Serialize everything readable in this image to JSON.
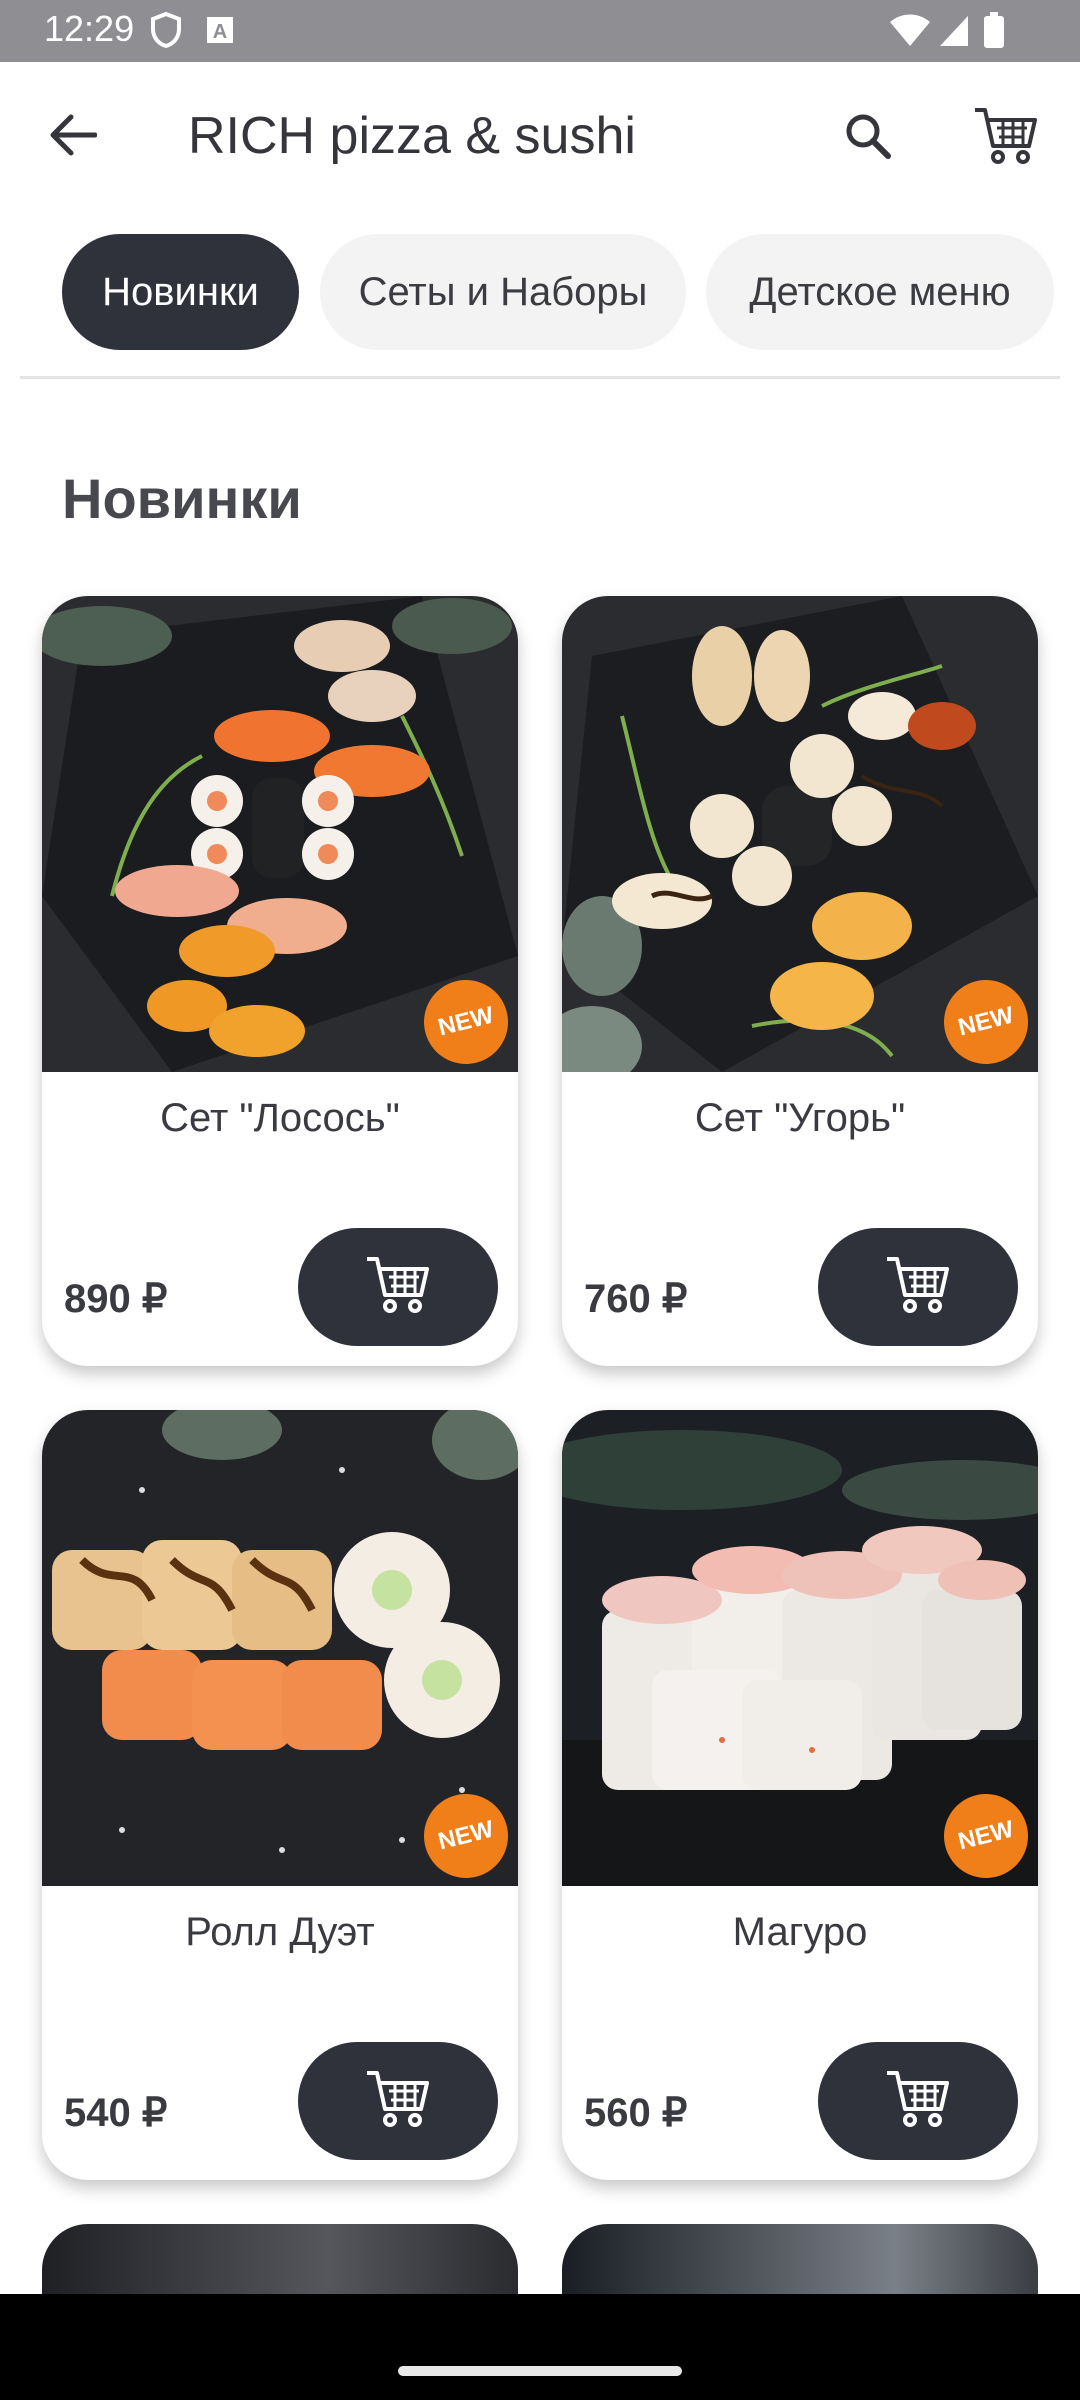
{
  "status_bar": {
    "time": "12:29",
    "icons": [
      "shield-icon",
      "a-box-icon",
      "wifi-icon",
      "signal-icon",
      "battery-icon"
    ]
  },
  "app_bar": {
    "title": "RICH pizza & sushi",
    "icons": [
      "back-arrow-icon",
      "search-icon",
      "cart-icon"
    ]
  },
  "tabs": [
    {
      "label": "Новинки",
      "active": true
    },
    {
      "label": "Сеты и Наборы",
      "active": false
    },
    {
      "label": "Детское меню",
      "active": false
    }
  ],
  "section": {
    "title": "Новинки"
  },
  "products": [
    {
      "name": "Сет \"Лосось\"",
      "price": "890 ₽",
      "badge": "NEW"
    },
    {
      "name": "Сет \"Угорь\"",
      "price": "760 ₽",
      "badge": "NEW"
    },
    {
      "name": "Ролл Дуэт",
      "price": "540 ₽",
      "badge": "NEW"
    },
    {
      "name": "Магуро",
      "price": "560 ₽",
      "badge": "NEW"
    }
  ],
  "colors": {
    "primary_dark": "#2f323b",
    "badge_orange": "#f07e19",
    "status_bar": "#8f8f93"
  }
}
